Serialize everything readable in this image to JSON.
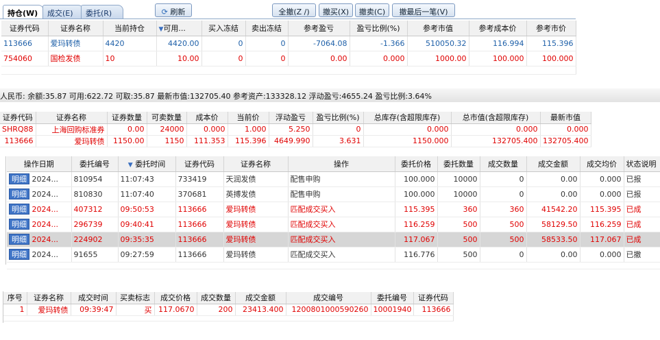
{
  "tabs": [
    {
      "label": "持仓(W)"
    },
    {
      "label": "成交(E)"
    },
    {
      "label": "委托(R)"
    }
  ],
  "toolbar": {
    "refresh": "刷新",
    "cancel_all": "全撤(Z /)",
    "cancel_buy": "撤买(X)",
    "cancel_sell": "撤卖(C)",
    "cancel_last": "撤最后一笔(V)"
  },
  "positions": {
    "headers": [
      "证券代码",
      "证券名称",
      "当前持仓",
      "可用...",
      "买入冻结",
      "卖出冻结",
      "参考盈亏",
      "盈亏比例(%)",
      "参考市值",
      "参考成本价",
      "参考市价"
    ],
    "sort_icon": "▼",
    "rows": [
      [
        "113666",
        "爱玛转债",
        "4420",
        "4420.00",
        "0",
        "0",
        "-7064.08",
        "-1.366",
        "510050.32",
        "116.994",
        "115.396"
      ],
      [
        "754060",
        "国检发债",
        "10",
        "10.00",
        "0",
        "0",
        "0.00",
        "0.000",
        "1000.00",
        "100.000",
        "100.000"
      ]
    ]
  },
  "summary": {
    "text": "人民币:  余额:35.87  可用:622.72  可取:35.87  最新市值:132705.40  参考资产:133328.12  浮动盈亏:4655.24  盈亏比例:3.64%"
  },
  "holdings": {
    "headers": [
      "证券代码",
      "证券名称",
      "证券数量",
      "可卖数量",
      "成本价",
      "当前价",
      "浮动盈亏",
      "盈亏比例(%)",
      "总库存(含超限库存)",
      "总市值(含超限库存)",
      "最新市值"
    ],
    "rows": [
      [
        "SHRQ88",
        "上海回购标准券",
        "0.00",
        "24000",
        "0.000",
        "1.000",
        "5.250",
        "0",
        "0.000",
        "0.000",
        "0.000"
      ],
      [
        "113666",
        "爱玛转债",
        "1150.00",
        "1150",
        "111.353",
        "115.396",
        "4649.990",
        "3.631",
        "1150.000",
        "132705.400",
        "132705.400"
      ]
    ]
  },
  "orders": {
    "headers": [
      "操作日期",
      "委托编号",
      "委托时间",
      "证券代码",
      "证券名称",
      "操作",
      "委托价格",
      "委托数量",
      "成交数量",
      "成交金额",
      "成交均价",
      "状态说明"
    ],
    "detail_label": "明细",
    "rows": [
      [
        "2024...",
        "810954",
        "11:07:43",
        "733419",
        "天润发债",
        "配售申购",
        "100.000",
        "10000",
        "0",
        "0.00",
        "0.000",
        "已报"
      ],
      [
        "2024...",
        "810830",
        "11:07:40",
        "370681",
        "英搏发债",
        "配售申购",
        "100.000",
        "10000",
        "0",
        "0.00",
        "0.000",
        "已报"
      ],
      [
        "2024...",
        "407312",
        "09:50:53",
        "113666",
        "爱玛转债",
        "匹配成交买入",
        "115.395",
        "360",
        "360",
        "41542.20",
        "115.395",
        "已成"
      ],
      [
        "2024...",
        "296739",
        "09:40:41",
        "113666",
        "爱玛转债",
        "匹配成交买入",
        "116.259",
        "500",
        "500",
        "58129.50",
        "116.259",
        "已成"
      ],
      [
        "2024...",
        "224902",
        "09:35:35",
        "113666",
        "爱玛转债",
        "匹配成交买入",
        "117.067",
        "500",
        "500",
        "58533.50",
        "117.067",
        "已成"
      ],
      [
        "2024...",
        "91655",
        "09:27:59",
        "113666",
        "爱玛转债",
        "匹配成交买入",
        "116.776",
        "500",
        "0",
        "0.00",
        "0.000",
        "已撤"
      ]
    ]
  },
  "trades": {
    "headers": [
      "序号",
      "证券名称",
      "成交时间",
      "买卖标志",
      "成交价格",
      "成交数量",
      "成交金额",
      "成交编号",
      "委托编号",
      "证券代码"
    ],
    "rows": [
      [
        "1",
        "爱玛转债",
        "09:39:47",
        "买",
        "117.0670",
        "200",
        "23413.400",
        "1200801000590260",
        "10001940",
        "113666"
      ]
    ]
  },
  "colors": {
    "red": "#e00000",
    "blue": "#1d5fa8",
    "selected_row": "#d6d6d6"
  }
}
